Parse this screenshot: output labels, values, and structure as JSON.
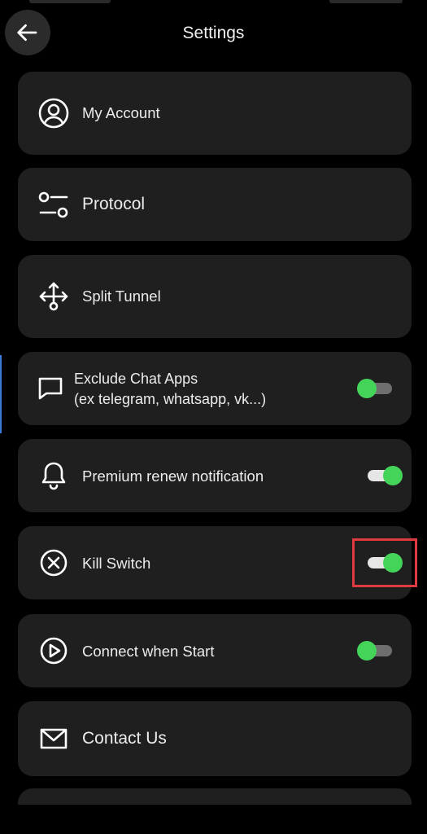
{
  "header": {
    "title": "Settings",
    "back_icon": "arrow-left-icon"
  },
  "settings": [
    {
      "id": "my-account",
      "label": "My Account",
      "icon": "account-circle-icon"
    },
    {
      "id": "protocol",
      "label": "Protocol",
      "icon": "sliders-icon"
    },
    {
      "id": "split-tunnel",
      "label": "Split Tunnel",
      "icon": "split-arrows-icon"
    },
    {
      "id": "exclude-chat-apps",
      "label": "Exclude Chat Apps",
      "sublabel": "(ex telegram, whatsapp, vk...)",
      "icon": "chat-bubble-icon",
      "toggle": "off"
    },
    {
      "id": "premium-renew",
      "label": "Premium renew notification",
      "icon": "bell-icon",
      "toggle": "on"
    },
    {
      "id": "kill-switch",
      "label": "Kill Switch",
      "icon": "close-circle-icon",
      "toggle": "on"
    },
    {
      "id": "connect-when-start",
      "label": "Connect when Start",
      "icon": "play-circle-icon",
      "toggle": "off"
    },
    {
      "id": "contact-us",
      "label": "Contact Us",
      "icon": "mail-icon"
    }
  ],
  "colors": {
    "background": "#000000",
    "card": "#1f1f1f",
    "toggle_knob": "#45d45a",
    "highlight": "#e0393e"
  }
}
